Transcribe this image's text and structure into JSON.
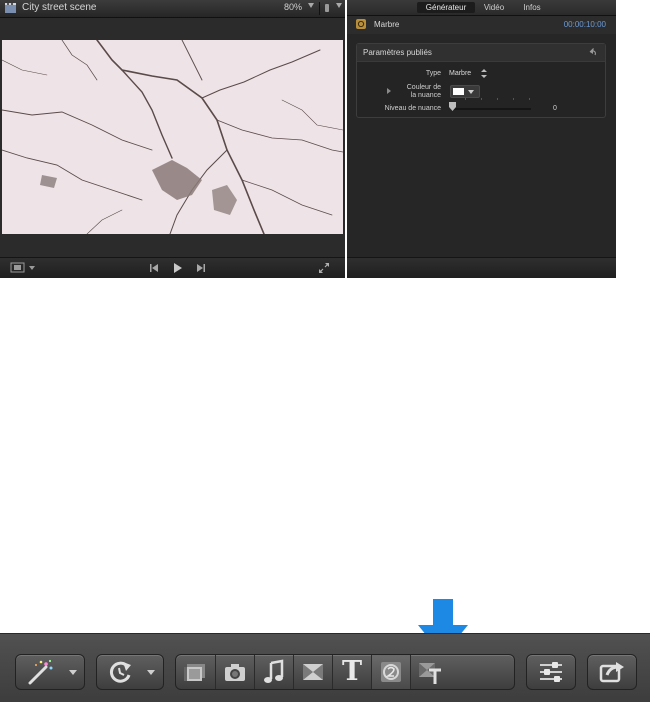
{
  "viewer": {
    "title": "City street scene",
    "zoom": "80%"
  },
  "inspector": {
    "tabs": [
      "Générateur",
      "Vidéo",
      "Infos"
    ],
    "active_tab": "Générateur",
    "generator_name": "Marbre",
    "timecode": "00:00:10:00",
    "section_title": "Paramètres publiés",
    "params": {
      "type_label": "Type",
      "type_value": "Marbre",
      "color_label_line1": "Couleur de",
      "color_label_line2": "la nuance",
      "color_value": "#ffffff",
      "level_label": "Niveau de nuance",
      "level_value": "0"
    }
  },
  "toolbar": {
    "buttons": [
      "magic-wand",
      "retime",
      "media-browser",
      "photos",
      "music",
      "transitions",
      "titles",
      "generators",
      "themes",
      "inspector",
      "share"
    ],
    "highlighted": "generators"
  },
  "colors": {
    "highlight_arrow": "#1e88e5",
    "timecode": "#6b9bd8"
  }
}
